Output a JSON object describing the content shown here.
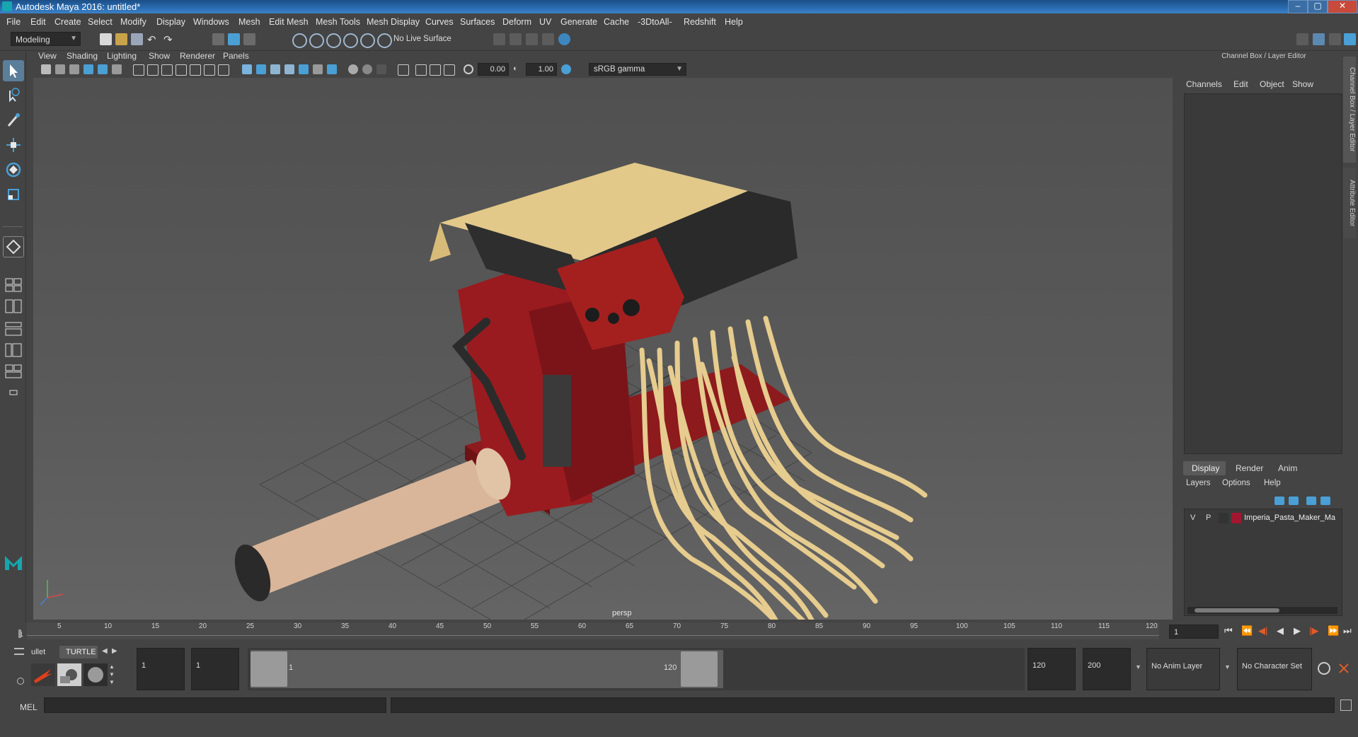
{
  "window": {
    "title": "Autodesk Maya 2016: untitled*",
    "min": "–",
    "max": "▢",
    "close": "✕"
  },
  "menu": [
    "File",
    "Edit",
    "Create",
    "Select",
    "Modify",
    "Display",
    "Windows",
    "Mesh",
    "Edit Mesh",
    "Mesh Tools",
    "Mesh Display",
    "Curves",
    "Surfaces",
    "Deform",
    "UV",
    "Generate",
    "Cache",
    "-3DtoAll-",
    "Redshift",
    "Help"
  ],
  "shelf": {
    "mode": "Modeling",
    "live_surface": "No Live Surface"
  },
  "viewport": {
    "menu": [
      "View",
      "Shading",
      "Lighting",
      "Show",
      "Renderer",
      "Panels"
    ],
    "exposure": "0.00",
    "gamma": "1.00",
    "color_space": "sRGB gamma",
    "camera_label": "persp"
  },
  "right_panel": {
    "header": "Channel Box / Layer Editor",
    "channel_tabs": [
      "Channels",
      "Edit",
      "Object",
      "Show"
    ],
    "layer_tabs": [
      "Display",
      "Render",
      "Anim"
    ],
    "layer_menu": [
      "Layers",
      "Options",
      "Help"
    ],
    "layer": {
      "v": "V",
      "p": "P",
      "name": "Imperia_Pasta_Maker_Ma",
      "color": "#a0172f"
    },
    "side_tabs": [
      "Channel Box / Layer Editor",
      "Attribute Editor"
    ]
  },
  "timeline": {
    "ticks": [
      "5",
      "10",
      "15",
      "20",
      "25",
      "30",
      "35",
      "40",
      "45",
      "50",
      "55",
      "60",
      "65",
      "70",
      "75",
      "80",
      "85",
      "90",
      "95",
      "100",
      "105",
      "110",
      "115",
      "120"
    ],
    "start_label": "1",
    "current_frame": "1"
  },
  "range": {
    "shelf_tabs": [
      "ullet",
      "TURTLE"
    ],
    "start": "1",
    "playback_start": "1",
    "range_start_label": "1",
    "range_end_label": "120",
    "playback_end": "120",
    "end": "200",
    "anim_layer": "No Anim Layer",
    "character_set": "No Character Set"
  },
  "cmdline": {
    "label": "MEL"
  },
  "colors": {
    "accent": "#4a9fd5",
    "pasta": "#e2c98a",
    "red_body": "#9a1b1f",
    "metal": "#2a2a2a",
    "handle": "#d9b69a"
  }
}
